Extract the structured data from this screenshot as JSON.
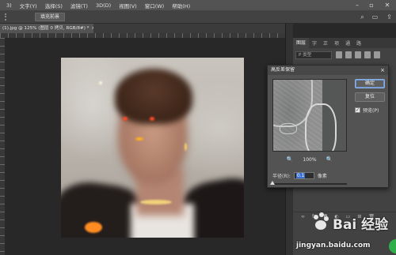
{
  "menu": {
    "items": [
      "3)",
      "文字(Y)",
      "选择(S)",
      "滤镜(T)",
      "3D(D)",
      "视图(V)",
      "窗口(W)",
      "帮助(H)"
    ]
  },
  "options": {
    "button_label": "填充前景"
  },
  "document": {
    "tab_title": "(1).jpg @ 125% (图层 0 拷贝, RGB/8#) *",
    "tab_close": "×"
  },
  "panel": {
    "tabs": [
      "图层",
      "字",
      "正",
      "项",
      "通",
      "路"
    ],
    "search_placeholder": "P 类型"
  },
  "dialog": {
    "title": "高反差保留",
    "ok_label": "确定",
    "reset_label": "复位",
    "preview_label": "预览(P)",
    "preview_checked": "✓",
    "zoom_value": "100%",
    "zoom_out": "🔍",
    "zoom_in": "🔍",
    "radius_label": "半径(R):",
    "radius_value": "0.1",
    "radius_unit": "像素",
    "radius_slider_level": 0.0
  },
  "watermark": {
    "logo_text": "Bai 经验",
    "site": "jingyan.baidu.com"
  },
  "colors": {
    "accent": "#3b6fd1",
    "menu_bg": "#535353",
    "workspace_bg": "#282828",
    "badge_green": "#2fae49"
  }
}
